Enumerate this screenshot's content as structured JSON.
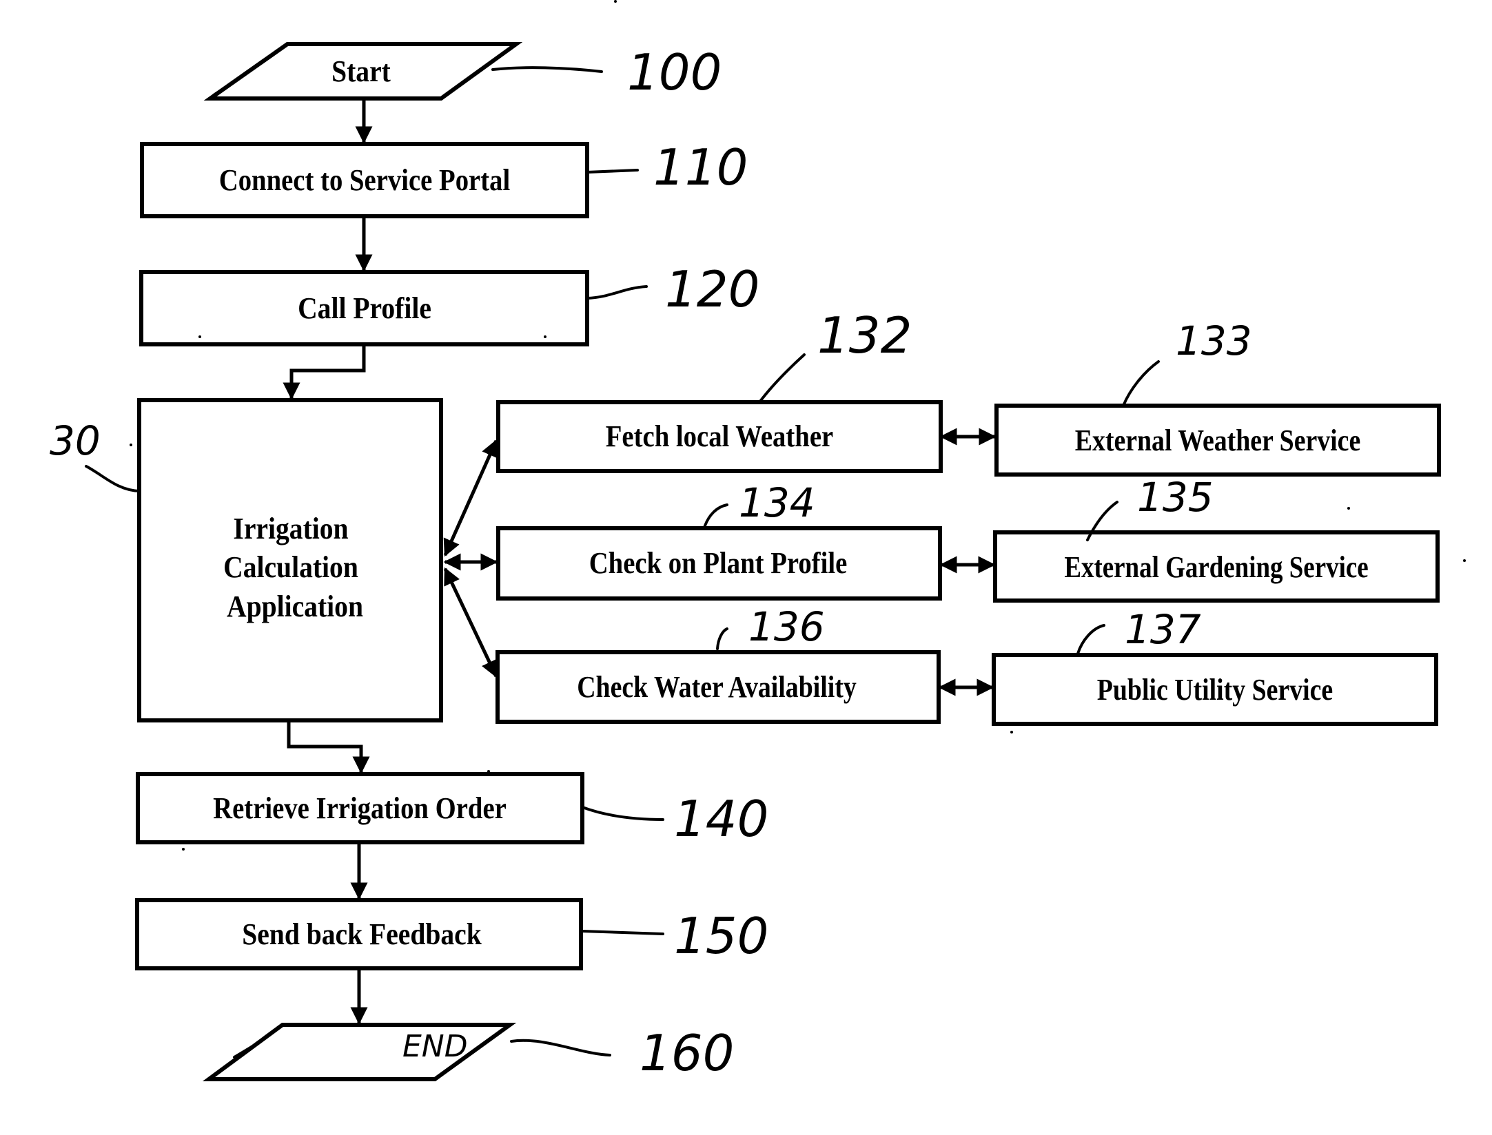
{
  "diagram": {
    "type": "flowchart",
    "steps": {
      "start": {
        "label": "Start",
        "ref": "100"
      },
      "connect": {
        "label": "Connect to Service Portal",
        "ref": "110"
      },
      "call_profile": {
        "label": "Call Profile",
        "ref": "120"
      },
      "irrigation_app": {
        "lines": [
          "Irrigation",
          "Calculation",
          "Application"
        ],
        "ref": "30"
      },
      "fetch_weather": {
        "label": "Fetch local Weather",
        "ref": "132"
      },
      "ext_weather": {
        "label": "External Weather Service",
        "ref": "133"
      },
      "plant_profile": {
        "label": "Check on Plant Profile",
        "ref": "134"
      },
      "ext_gardening": {
        "label": "External Gardening Service",
        "ref": "135"
      },
      "water_avail": {
        "label": "Check Water Availability",
        "ref": "136"
      },
      "public_utility": {
        "label": "Public Utility Service",
        "ref": "137"
      },
      "retrieve_order": {
        "label": "Retrieve Irrigation Order",
        "ref": "140"
      },
      "send_feedback": {
        "label": "Send back Feedback",
        "ref": "150"
      },
      "end": {
        "label": "END",
        "ref": "160"
      }
    },
    "edges": [
      {
        "from": "start",
        "to": "connect",
        "kind": "arrow"
      },
      {
        "from": "connect",
        "to": "call_profile",
        "kind": "arrow"
      },
      {
        "from": "call_profile",
        "to": "irrigation_app",
        "kind": "elbow-arrow"
      },
      {
        "from": "irrigation_app",
        "to": "fetch_weather",
        "kind": "bidirectional"
      },
      {
        "from": "irrigation_app",
        "to": "plant_profile",
        "kind": "bidirectional"
      },
      {
        "from": "irrigation_app",
        "to": "water_avail",
        "kind": "bidirectional"
      },
      {
        "from": "fetch_weather",
        "to": "ext_weather",
        "kind": "bidirectional"
      },
      {
        "from": "plant_profile",
        "to": "ext_gardening",
        "kind": "bidirectional"
      },
      {
        "from": "water_avail",
        "to": "public_utility",
        "kind": "bidirectional"
      },
      {
        "from": "irrigation_app",
        "to": "retrieve_order",
        "kind": "elbow-arrow"
      },
      {
        "from": "retrieve_order",
        "to": "send_feedback",
        "kind": "arrow"
      },
      {
        "from": "send_feedback",
        "to": "end",
        "kind": "arrow"
      }
    ]
  }
}
